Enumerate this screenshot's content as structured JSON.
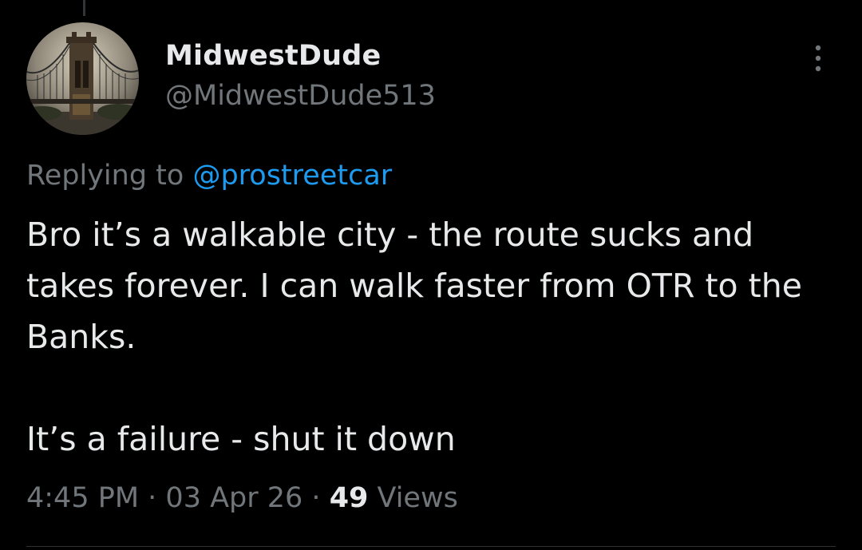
{
  "tweet": {
    "display_name": "MidwestDude",
    "handle": "@MidwestDude513",
    "replying_prefix": "Replying to ",
    "replying_to": "@prostreetcar",
    "paragraph_1": "Bro it’s a walkable city - the route sucks and takes forever. I can walk faster from OTR to the Banks.",
    "paragraph_2": "It’s a failure - shut it down",
    "time": "4:45 PM",
    "separator": " · ",
    "date": "03 Apr 26",
    "views_count": "49",
    "views_label": " Views"
  },
  "icons": {
    "more": "more-vertical-icon"
  },
  "colors": {
    "background": "#000000",
    "text_primary": "#e7e9ea",
    "text_secondary": "#71767b",
    "link": "#1d9bf0"
  }
}
